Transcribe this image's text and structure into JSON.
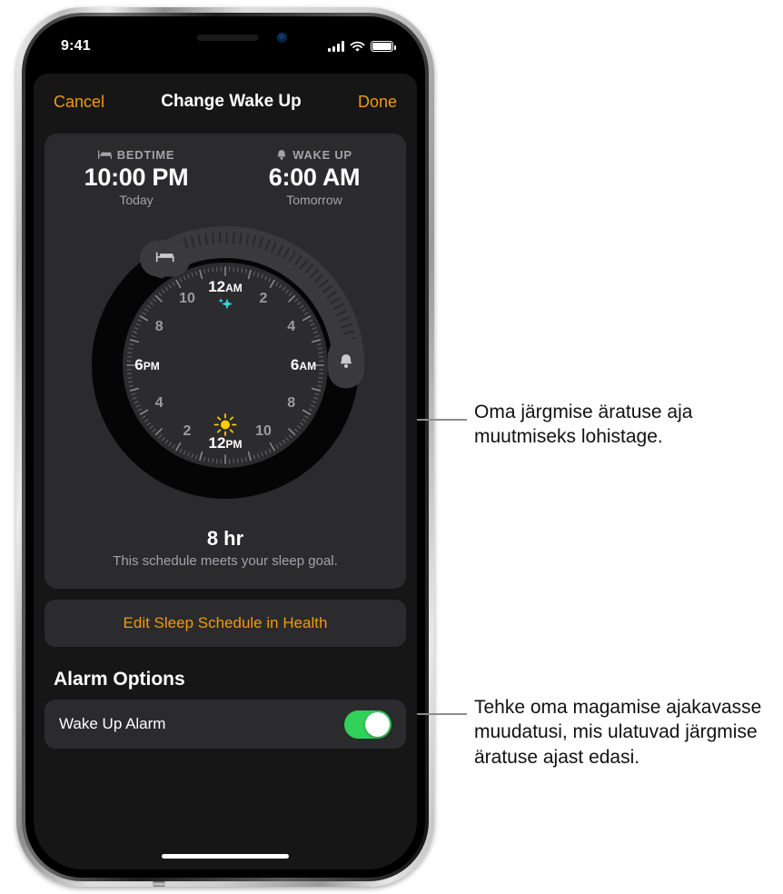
{
  "status_bar": {
    "time": "9:41",
    "signal_icon": "cellular-signal-icon",
    "wifi_icon": "wifi-icon",
    "battery_icon": "battery-icon"
  },
  "nav": {
    "cancel_label": "Cancel",
    "title": "Change Wake Up",
    "done_label": "Done"
  },
  "sleep_card": {
    "bedtime": {
      "icon": "bed-icon",
      "label": "BEDTIME",
      "time": "10:00 PM",
      "day": "Today"
    },
    "wakeup": {
      "icon": "bell-icon",
      "label": "WAKE UP",
      "time": "6:00 AM",
      "day": "Tomorrow"
    },
    "duration": "8 hr",
    "goal_text": "This schedule meets your sleep goal."
  },
  "dial": {
    "bedtime_handle_icon": "bed-handle-icon",
    "wakeup_handle_icon": "bell-handle-icon",
    "moon_icon": "stars-icon",
    "sun_icon": "sun-icon",
    "hours": [
      {
        "text": "12AM",
        "ampm": "AM",
        "num": "12",
        "angle": 0,
        "major": true
      },
      {
        "text": "2",
        "ampm": "",
        "num": "2",
        "angle": 30,
        "major": false
      },
      {
        "text": "4",
        "ampm": "",
        "num": "4",
        "angle": 60,
        "major": false
      },
      {
        "text": "6AM",
        "ampm": "AM",
        "num": "6",
        "angle": 90,
        "major": true
      },
      {
        "text": "8",
        "ampm": "",
        "num": "8",
        "angle": 120,
        "major": false
      },
      {
        "text": "10",
        "ampm": "",
        "num": "10",
        "angle": 150,
        "major": false
      },
      {
        "text": "12PM",
        "ampm": "PM",
        "num": "12",
        "angle": 180,
        "major": true
      },
      {
        "text": "2",
        "ampm": "",
        "num": "2",
        "angle": 210,
        "major": false
      },
      {
        "text": "4",
        "ampm": "",
        "num": "4",
        "angle": 240,
        "major": false
      },
      {
        "text": "6PM",
        "ampm": "PM",
        "num": "6",
        "angle": 270,
        "major": true
      },
      {
        "text": "8",
        "ampm": "",
        "num": "8",
        "angle": 300,
        "major": false
      },
      {
        "text": "10",
        "ampm": "",
        "num": "10",
        "angle": 330,
        "major": false
      }
    ],
    "arc_start_hour": 22,
    "arc_end_hour": 30
  },
  "health_button": {
    "label": "Edit Sleep Schedule in Health"
  },
  "alarm_options": {
    "section_title": "Alarm Options",
    "rows": [
      {
        "label": "Wake Up Alarm",
        "toggle_on": true
      }
    ]
  },
  "callouts": [
    {
      "text": "Oma järgmise äratuse aja muutmiseks lohistage."
    },
    {
      "text": "Tehke oma magamise ajakavasse muudatusi, mis ulatuvad järgmise äratuse ajast edasi."
    }
  ],
  "colors": {
    "accent_orange": "#f09a0a",
    "toggle_green": "#30d158",
    "card_bg": "#2b2b2d",
    "screen_bg": "#000000",
    "sheet_bg": "#161617",
    "sun_yellow": "#ffcc00",
    "stars_cyan": "#32d8e0"
  }
}
